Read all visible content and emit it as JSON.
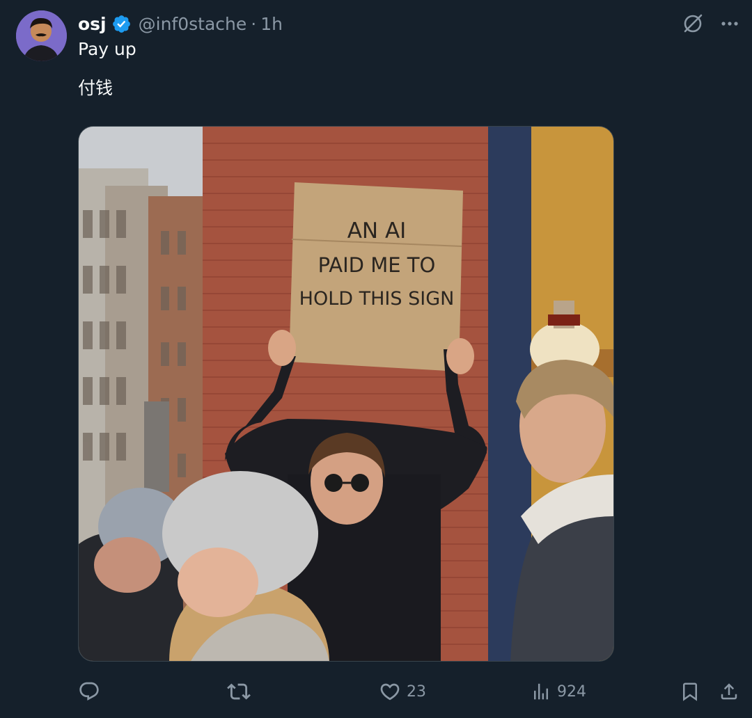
{
  "tweet": {
    "author": {
      "name": "osj",
      "verified": true,
      "handle": "@inf0stache",
      "separator": "·",
      "time": "1h"
    },
    "text_lines": [
      "Pay up",
      "付钱"
    ],
    "media": {
      "sign_lines": [
        "AN AI",
        "PAID ME TO",
        "HOLD THIS SIGN"
      ]
    },
    "metrics": {
      "likes": "23",
      "views": "924"
    }
  },
  "icons": {
    "verified": "verified-badge-icon",
    "grok": "grok-icon",
    "more": "more-icon",
    "reply": "reply-icon",
    "retweet": "retweet-icon",
    "like": "heart-icon",
    "views": "views-chart-icon",
    "bookmark": "bookmark-icon",
    "share": "share-icon"
  },
  "colors": {
    "background": "#15202b",
    "text_primary": "#f7f9f9",
    "text_secondary": "#8b98a5",
    "verified_blue": "#1d9bf0",
    "border": "#38444d"
  }
}
